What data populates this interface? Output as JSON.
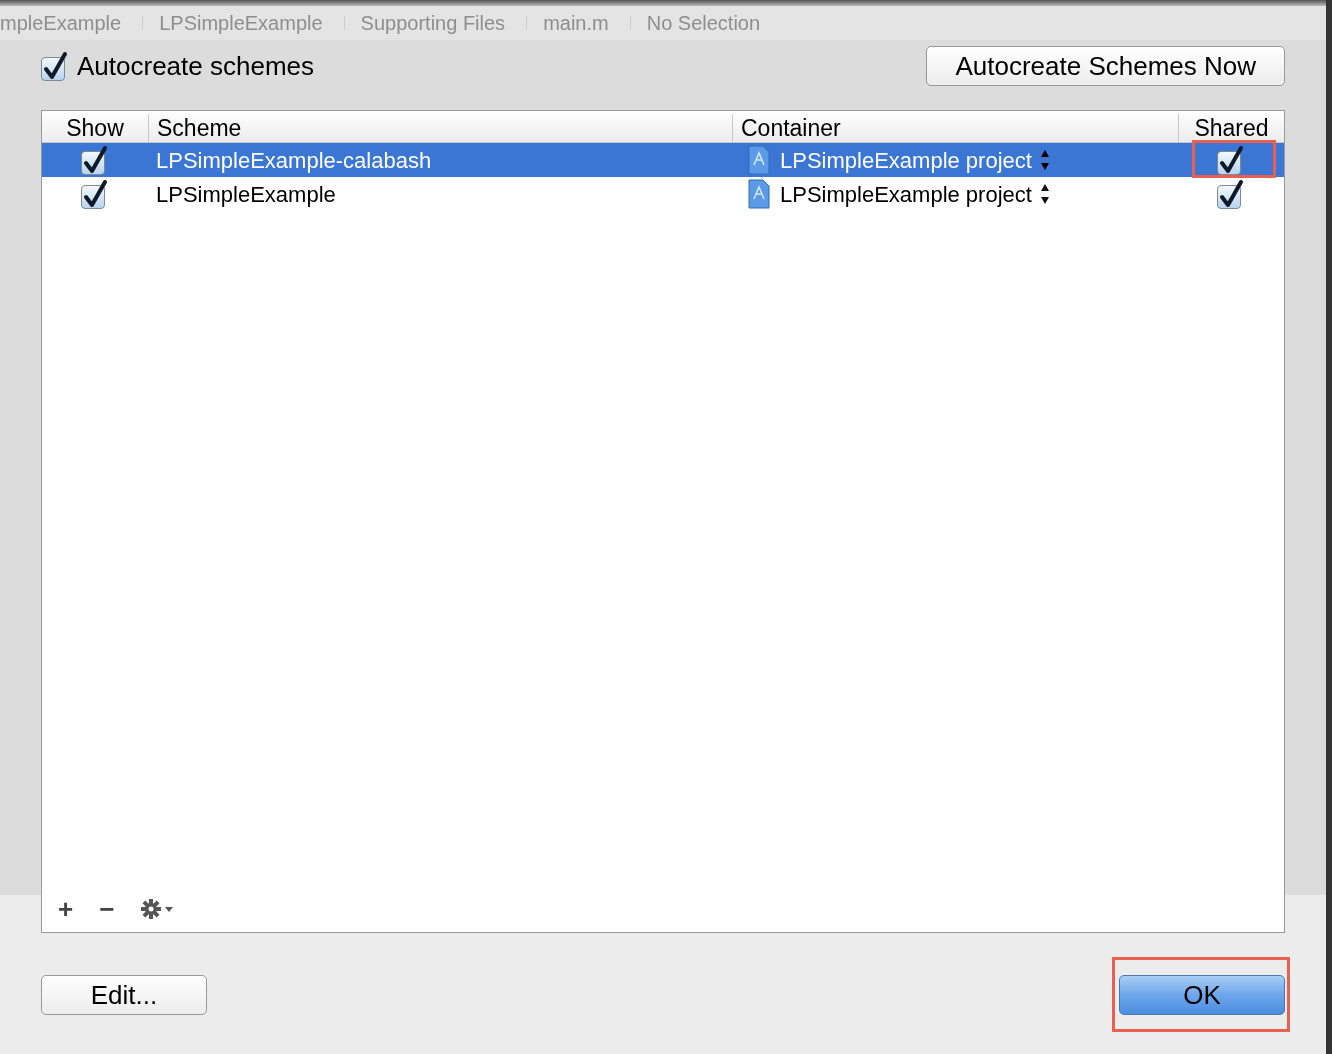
{
  "breadcrumb": [
    "mpleExample",
    "LPSimpleExample",
    "Supporting Files",
    "main.m",
    "No Selection"
  ],
  "autocreate": {
    "label": "Autocreate schemes",
    "checked": true
  },
  "autocreate_now_button": "Autocreate Schemes Now",
  "table": {
    "columns": [
      "Show",
      "Scheme",
      "Container",
      "Shared"
    ],
    "rows": [
      {
        "show": true,
        "scheme": "LPSimpleExample-calabash",
        "container": "LPSimpleExample project",
        "shared": true,
        "selected": true,
        "highlighted": true
      },
      {
        "show": true,
        "scheme": "LPSimpleExample",
        "container": "LPSimpleExample project",
        "shared": true,
        "selected": false,
        "highlighted": false
      }
    ]
  },
  "toolbar": [
    "+",
    "−"
  ],
  "buttons": [
    {
      "label": "Edit...",
      "kind": "plain",
      "highlighted": false
    },
    {
      "label": "OK",
      "kind": "default",
      "highlighted": true
    }
  ]
}
